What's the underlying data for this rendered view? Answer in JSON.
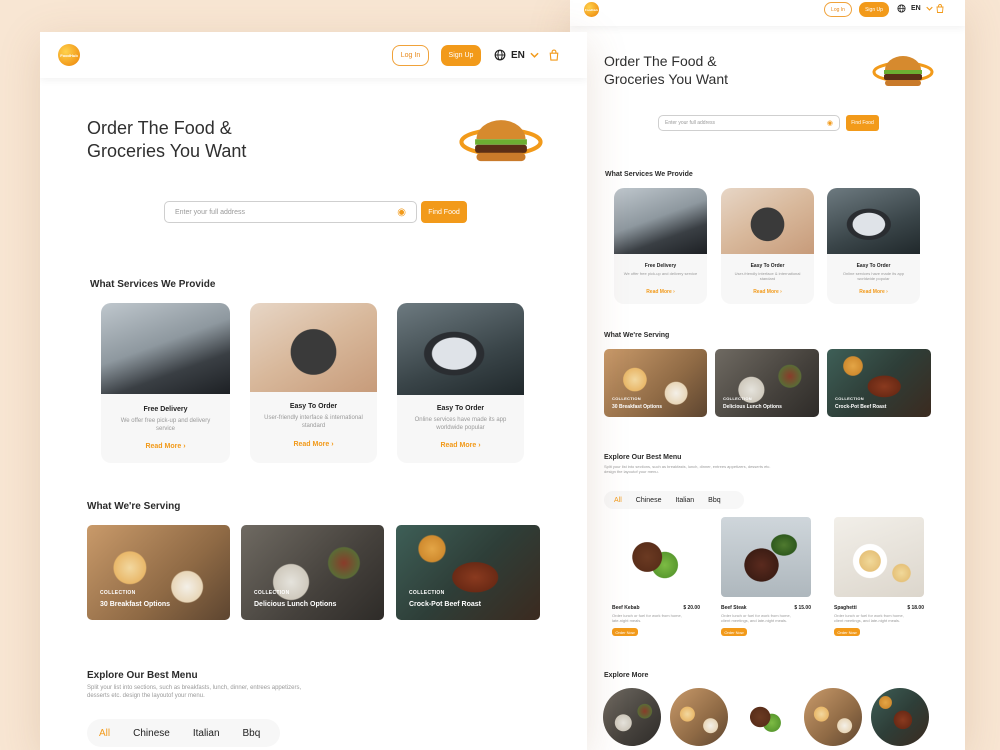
{
  "brand": {
    "logo_text": "FoodHub",
    "accent": "#f29a1a",
    "background": "#f8e6d3"
  },
  "header": {
    "login": "Log In",
    "signup": "Sign Up",
    "language": "EN",
    "language_icon": "globe-icon",
    "cart_icon": "bag-icon"
  },
  "hero": {
    "title_line1": "Order The Food &",
    "title_line2": "Groceries You Want",
    "search_placeholder": "Enter your full address",
    "find_button": "Find Food",
    "location_icon": "target-icon"
  },
  "services": {
    "heading": "What Services We Provide",
    "items": [
      {
        "title": "Free Delivery",
        "description": "We offer free pick-up and delivery service",
        "link": "Read More"
      },
      {
        "title": "Easy To Order",
        "description": "User-friendly interface & international standard",
        "link": "Read More"
      },
      {
        "title": "Easy To Order",
        "description": "Online services have made its app worldwide popular",
        "link": "Read More"
      }
    ]
  },
  "serving": {
    "heading": "What We're Serving",
    "items": [
      {
        "tag": "COLLECTION",
        "name": "30 Breakfast Options"
      },
      {
        "tag": "COLLECTION",
        "name": "Delicious Lunch Options"
      },
      {
        "tag": "COLLECTION",
        "name": "Crock-Pot Beef Roast"
      }
    ]
  },
  "menu": {
    "heading": "Explore Our Best Menu",
    "subtitle": "Split your list into sections, such as breakfasts, lunch, dinner, entrees appetizers, desserts etc. design the layoutof your menu.",
    "tabs": [
      "All",
      "Chinese",
      "Italian",
      "Bbq"
    ],
    "active_tab": "All",
    "dishes": [
      {
        "name": "Beef Kebab",
        "price": "$ 20.00",
        "description": "Order lunch or fuel for work from home, late-night meals.",
        "button": "Order Now"
      },
      {
        "name": "Beef Steak",
        "price": "$ 15.00",
        "description": "Order lunch or fuel for work from home, client meetings, and late-night meals.",
        "button": "Order Now"
      },
      {
        "name": "Spaghetti",
        "price": "$ 18.00",
        "description": "Order lunch or fuel for work from home, client meetings, and late-night meals.",
        "button": "Order Now"
      }
    ]
  },
  "explore": {
    "heading": "Explore More",
    "count": 5
  }
}
